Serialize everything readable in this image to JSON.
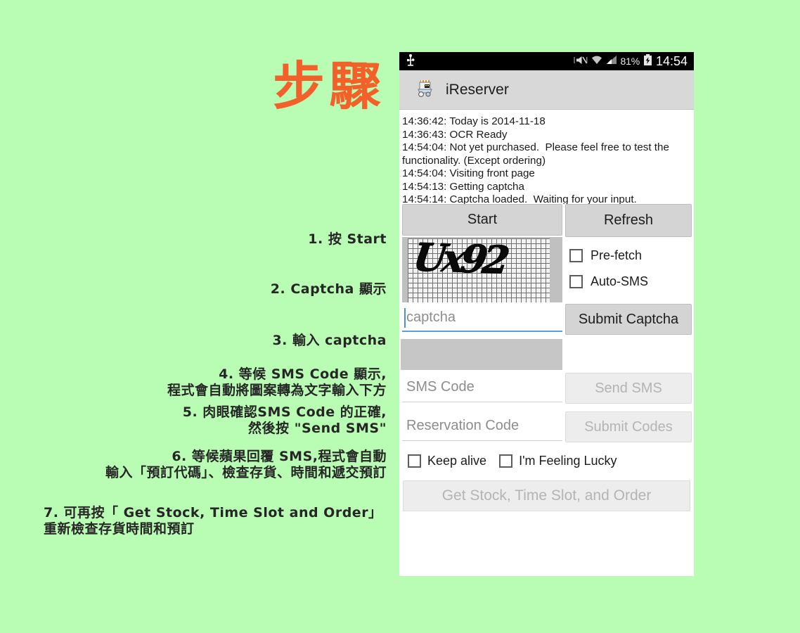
{
  "page": {
    "background_color": "#b9fcb4",
    "title_text": "步驟",
    "title_color": "#f4602a"
  },
  "steps": [
    {
      "id": "step-1",
      "text": "1. 按 Start"
    },
    {
      "id": "step-2",
      "text": "2. Captcha 顯示"
    },
    {
      "id": "step-3",
      "text": "3. 輸入 captcha"
    },
    {
      "id": "step-4",
      "text": "4. 等候 SMS Code 顯示,\n程式會自動將圖案轉為文字輸入下方"
    },
    {
      "id": "step-5",
      "text": "5. 肉眼確認SMS Code 的正確,\n然後按 \"Send SMS\""
    },
    {
      "id": "step-6",
      "text": "6. 等候蘋果回覆 SMS,程式會自動\n輸入「預訂代碼」、檢查存貨、時間和遞交預訂"
    },
    {
      "id": "step-7",
      "text": "7. 可再按「 Get Stock, Time Slot and Order」\n重新檢查存貨時間和預訂"
    }
  ],
  "phone": {
    "status_bar": {
      "usb_icon": "usb-icon",
      "mute_icon": "vibrate-mute-icon",
      "wifi_icon": "wifi-icon",
      "signal_icon": "signal-bars-icon",
      "battery_percent": "81%",
      "battery_icon": "battery-charging-icon",
      "clock": "14:54"
    },
    "action_bar": {
      "app_icon": "ireserver-app-icon",
      "app_title": "iReserver"
    },
    "log": "14:36:42: Today is 2014-11-18\n14:36:43: OCR Ready\n14:54:04: Not yet purchased.  Please feel free to test the functionality. (Except ordering)\n14:54:04: Visiting front page\n14:54:13: Getting captcha\n14:54:14: Captcha loaded.  Waiting for your input.",
    "buttons": {
      "start": "Start",
      "refresh": "Refresh",
      "submit_captcha": "Submit Captcha",
      "send_sms": "Send SMS",
      "submit_codes": "Submit Codes",
      "get_stock": "Get Stock, Time Slot, and Order"
    },
    "captcha": {
      "image_alt": "captcha-image",
      "rendered_text": "Ux92"
    },
    "checkboxes": {
      "pre_fetch": "Pre-fetch",
      "auto_sms": "Auto-SMS",
      "keep_alive": "Keep alive",
      "feeling_lucky": "I'm Feeling Lucky"
    },
    "inputs": {
      "captcha_placeholder": "captcha",
      "captcha_value": "",
      "sms_placeholder": "SMS Code",
      "sms_value": "",
      "reservation_placeholder": "Reservation Code",
      "reservation_value": ""
    },
    "ocr_result": ""
  }
}
